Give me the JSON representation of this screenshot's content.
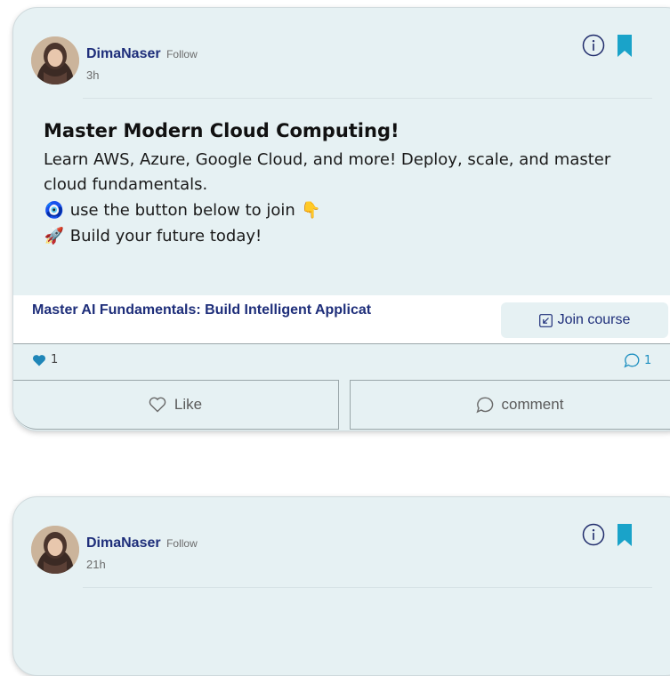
{
  "posts": [
    {
      "author": "DimaNaser",
      "follow_label": "Follow",
      "time": "3h",
      "title": "Master Modern Cloud Computing!",
      "body": "Learn AWS, Azure, Google Cloud, and more! Deploy, scale, and master cloud fundamentals.",
      "line1_emoji": "🧿",
      "line1_text": "use the button below to join",
      "line1_end_emoji": "👇",
      "line2_emoji": "🚀",
      "line2_text": "Build your future today!",
      "course_title": "Master AI Fundamentals: Build Intelligent Applicat",
      "join_label": "Join course",
      "likes": "1",
      "comments": "1",
      "like_label": "Like",
      "comment_label": "comment"
    },
    {
      "author": "DimaNaser",
      "follow_label": "Follow",
      "time": "21h"
    }
  ],
  "icons": {
    "info": "info-circle-icon",
    "bookmark": "bookmark-icon",
    "heart": "heart-icon",
    "comment": "speech-bubble-icon",
    "join": "arrow-down-left-box-icon"
  },
  "colors": {
    "card_bg": "#e6f1f3",
    "author_blue": "#1e2e7a",
    "bookmark_teal": "#1aa3c9",
    "comment_blue": "#1d8fc0",
    "heart_blue": "#1f86b8"
  }
}
